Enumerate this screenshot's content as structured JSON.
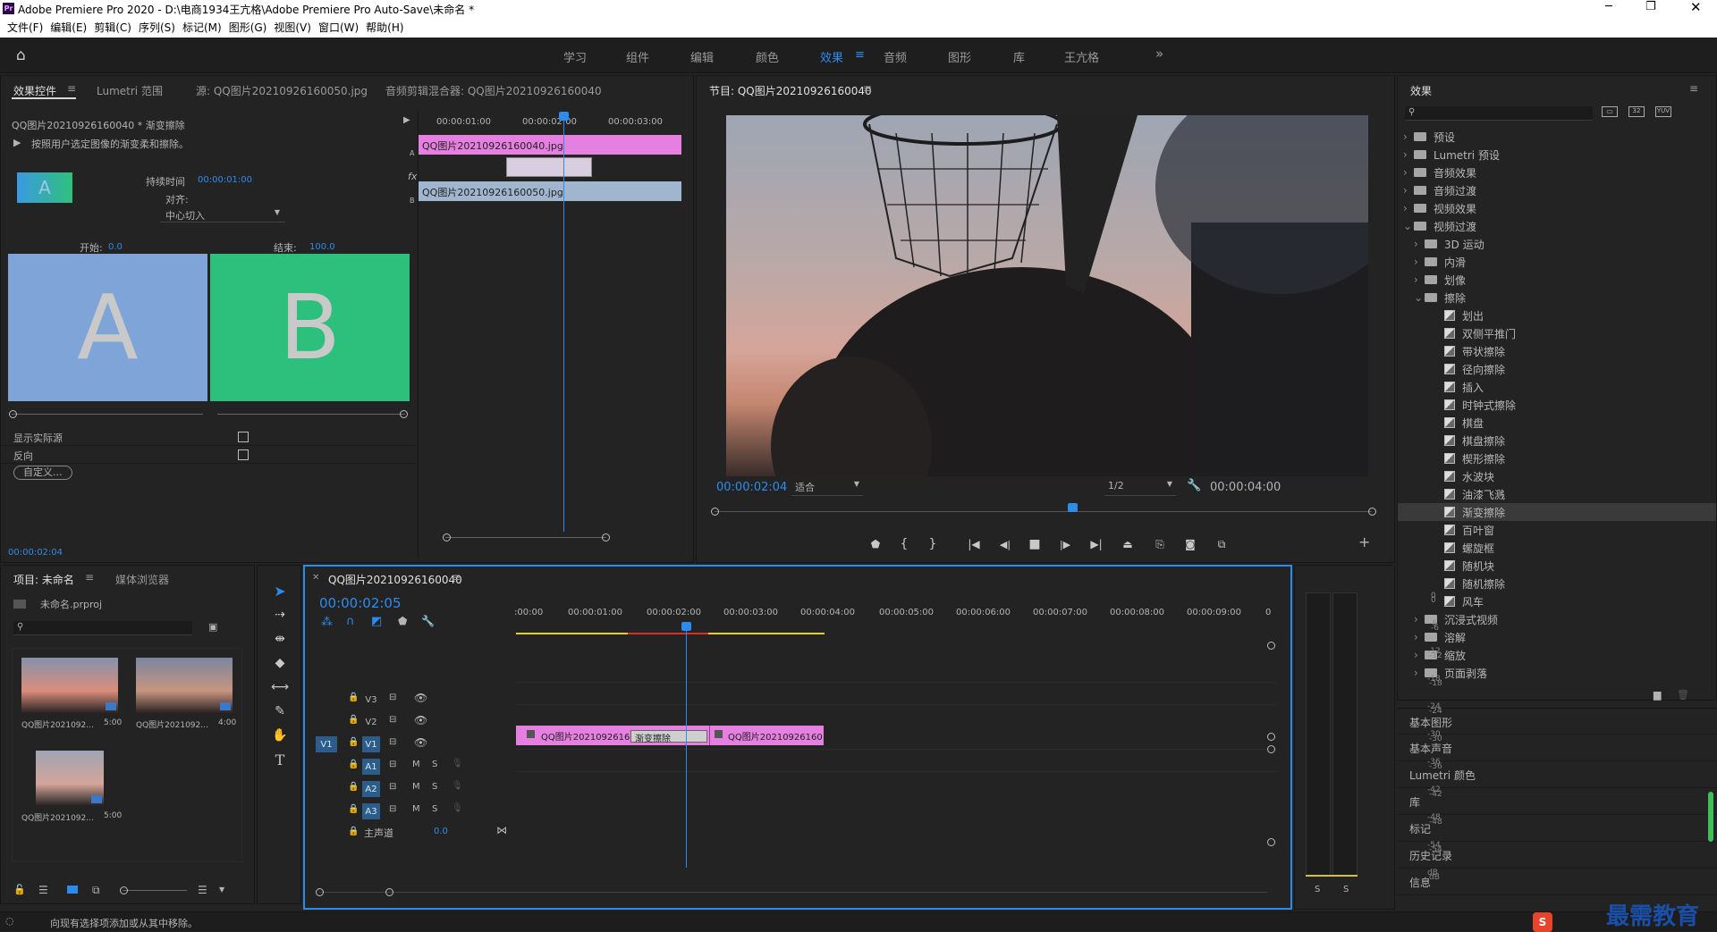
{
  "window": {
    "title": "Adobe Premiere Pro 2020 - D:\\电商1934王亢格\\Adobe Premiere Pro Auto-Save\\未命名 *",
    "app_icon": "Pr"
  },
  "menu": [
    "文件(F)",
    "编辑(E)",
    "剪辑(C)",
    "序列(S)",
    "标记(M)",
    "图形(G)",
    "视图(V)",
    "窗口(W)",
    "帮助(H)"
  ],
  "workspaces": [
    "学习",
    "组件",
    "编辑",
    "颜色",
    "效果",
    "音频",
    "图形",
    "库",
    "王亢格"
  ],
  "workspace_active": "效果",
  "effect_controls": {
    "tabs": [
      "效果控件",
      "Lumetri 范围",
      "源: QQ图片20210926160050.jpg",
      "音频剪辑混合器: QQ图片20210926160040"
    ],
    "clip_label": "QQ图片20210926160040 * 渐变擦除",
    "description": "按照用户选定图像的渐变柔和擦除。",
    "duration_label": "持续时间",
    "duration_value": "00:00:01:00",
    "align_label": "对齐:",
    "align_value": "中心切入",
    "start_label": "开始:",
    "start_value": "0.0",
    "end_label": "结束:",
    "end_value": "100.0",
    "preview_a": "A",
    "preview_b": "B",
    "thumb_a": "A",
    "show_source": "显示实际源",
    "reverse": "反向",
    "custom": "自定义...",
    "mini_timecodes": [
      "00:00:01:00",
      "00:00:02:00",
      "00:00:03:00"
    ],
    "mini_clip_a": "QQ图片20210926160040.jpg",
    "mini_clip_b": "QQ图片20210926160050.jpg",
    "timecode": "00:00:02:04"
  },
  "program": {
    "title": "节目: QQ图片20210926160040",
    "timecode": "00:00:02:04",
    "fit": "适合",
    "res": "1/2",
    "duration": "00:00:04:00"
  },
  "effects_panel": {
    "title": "效果",
    "tree": [
      {
        "label": "预设",
        "level": 0,
        "type": "folder",
        "open": false
      },
      {
        "label": "Lumetri 预设",
        "level": 0,
        "type": "folder",
        "open": false
      },
      {
        "label": "音频效果",
        "level": 0,
        "type": "folder",
        "open": false
      },
      {
        "label": "音频过渡",
        "level": 0,
        "type": "folder",
        "open": false
      },
      {
        "label": "视频效果",
        "level": 0,
        "type": "folder",
        "open": false
      },
      {
        "label": "视频过渡",
        "level": 0,
        "type": "folder",
        "open": true
      },
      {
        "label": "3D 运动",
        "level": 1,
        "type": "folder",
        "open": false
      },
      {
        "label": "内滑",
        "level": 1,
        "type": "folder",
        "open": false
      },
      {
        "label": "划像",
        "level": 1,
        "type": "folder",
        "open": false
      },
      {
        "label": "擦除",
        "level": 1,
        "type": "folder",
        "open": true
      },
      {
        "label": "划出",
        "level": 2,
        "type": "fx"
      },
      {
        "label": "双侧平推门",
        "level": 2,
        "type": "fx"
      },
      {
        "label": "带状擦除",
        "level": 2,
        "type": "fx"
      },
      {
        "label": "径向擦除",
        "level": 2,
        "type": "fx"
      },
      {
        "label": "插入",
        "level": 2,
        "type": "fx"
      },
      {
        "label": "时钟式擦除",
        "level": 2,
        "type": "fx"
      },
      {
        "label": "棋盘",
        "level": 2,
        "type": "fx"
      },
      {
        "label": "棋盘擦除",
        "level": 2,
        "type": "fx"
      },
      {
        "label": "楔形擦除",
        "level": 2,
        "type": "fx"
      },
      {
        "label": "水波块",
        "level": 2,
        "type": "fx"
      },
      {
        "label": "油漆飞溅",
        "level": 2,
        "type": "fx"
      },
      {
        "label": "渐变擦除",
        "level": 2,
        "type": "fx",
        "selected": true
      },
      {
        "label": "百叶窗",
        "level": 2,
        "type": "fx"
      },
      {
        "label": "螺旋框",
        "level": 2,
        "type": "fx"
      },
      {
        "label": "随机块",
        "level": 2,
        "type": "fx"
      },
      {
        "label": "随机擦除",
        "level": 2,
        "type": "fx"
      },
      {
        "label": "风车",
        "level": 2,
        "type": "fx"
      },
      {
        "label": "沉浸式视频",
        "level": 1,
        "type": "folder",
        "open": false
      },
      {
        "label": "溶解",
        "level": 1,
        "type": "folder",
        "open": false
      },
      {
        "label": "缩放",
        "level": 1,
        "type": "folder",
        "open": false
      },
      {
        "label": "页面剥落",
        "level": 1,
        "type": "folder",
        "open": false
      }
    ],
    "sections": [
      "基本图形",
      "基本声音",
      "Lumetri 颜色",
      "库",
      "标记",
      "历史记录",
      "信息"
    ]
  },
  "project": {
    "tabs": [
      "项目: 未命名",
      "媒体浏览器"
    ],
    "file": "未命名.prproj",
    "items": [
      {
        "name": "QQ图片2021092...",
        "dur": "5:00"
      },
      {
        "name": "QQ图片2021092...",
        "dur": "4:00"
      },
      {
        "name": "QQ图片2021092...",
        "dur": "5:00"
      }
    ]
  },
  "timeline": {
    "tab": "QQ图片20210926160040",
    "timecode": "00:00:02:05",
    "ruler": [
      ":00:00",
      "00:00:01:00",
      "00:00:02:00",
      "00:00:03:00",
      "00:00:04:00",
      "00:00:05:00",
      "00:00:06:00",
      "00:00:07:00",
      "00:00:08:00",
      "00:00:09:00",
      "0"
    ],
    "tracks": [
      {
        "name": "V3",
        "kind": "video"
      },
      {
        "name": "V2",
        "kind": "video"
      },
      {
        "name": "V1",
        "kind": "video",
        "src": "V1"
      },
      {
        "name": "A1",
        "kind": "audio"
      },
      {
        "name": "A2",
        "kind": "audio"
      },
      {
        "name": "A3",
        "kind": "audio"
      }
    ],
    "master": "主声道",
    "master_val": "0.0",
    "clip1": "QQ图片20210926160",
    "transition": "渐变擦除",
    "clip2": "QQ图片20210926160"
  },
  "meter": {
    "labels": [
      "0",
      "-6",
      "-12",
      "-18",
      "-24",
      "-30",
      "-36",
      "-42",
      "-48",
      "-54",
      "dB"
    ],
    "solo": [
      "S",
      "S"
    ]
  },
  "status": "向现有选择项添加或从其中移除。",
  "watermark": "最需教育",
  "colors": {
    "accent": "#2d8ceb",
    "clip_pink": "#e57fe0",
    "clip_blue": "#9fb6ce",
    "preview_a": "#7fa5d8",
    "preview_b": "#2dc07d"
  }
}
